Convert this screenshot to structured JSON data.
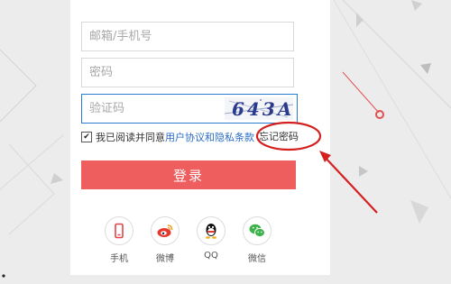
{
  "form": {
    "email_placeholder": "邮箱/手机号",
    "password_placeholder": "密码",
    "captcha_placeholder": "验证码",
    "captcha_image_text": "643A",
    "agree_prefix": "我已阅读并同意",
    "agree_link": "用户协议和隐私条款",
    "agree_checked_mark": "✔",
    "forgot_password": "忘记密码",
    "login_button": "登录"
  },
  "social": [
    {
      "label": "手机",
      "icon": "phone-icon"
    },
    {
      "label": "微博",
      "icon": "weibo-icon"
    },
    {
      "label": "QQ",
      "icon": "qq-icon"
    },
    {
      "label": "微信",
      "icon": "wechat-icon"
    }
  ],
  "colors": {
    "accent_red": "#ee5e5e",
    "link_blue": "#2b6cc4",
    "annotation_red": "#d42020",
    "focus_border": "#2b7cd3"
  }
}
